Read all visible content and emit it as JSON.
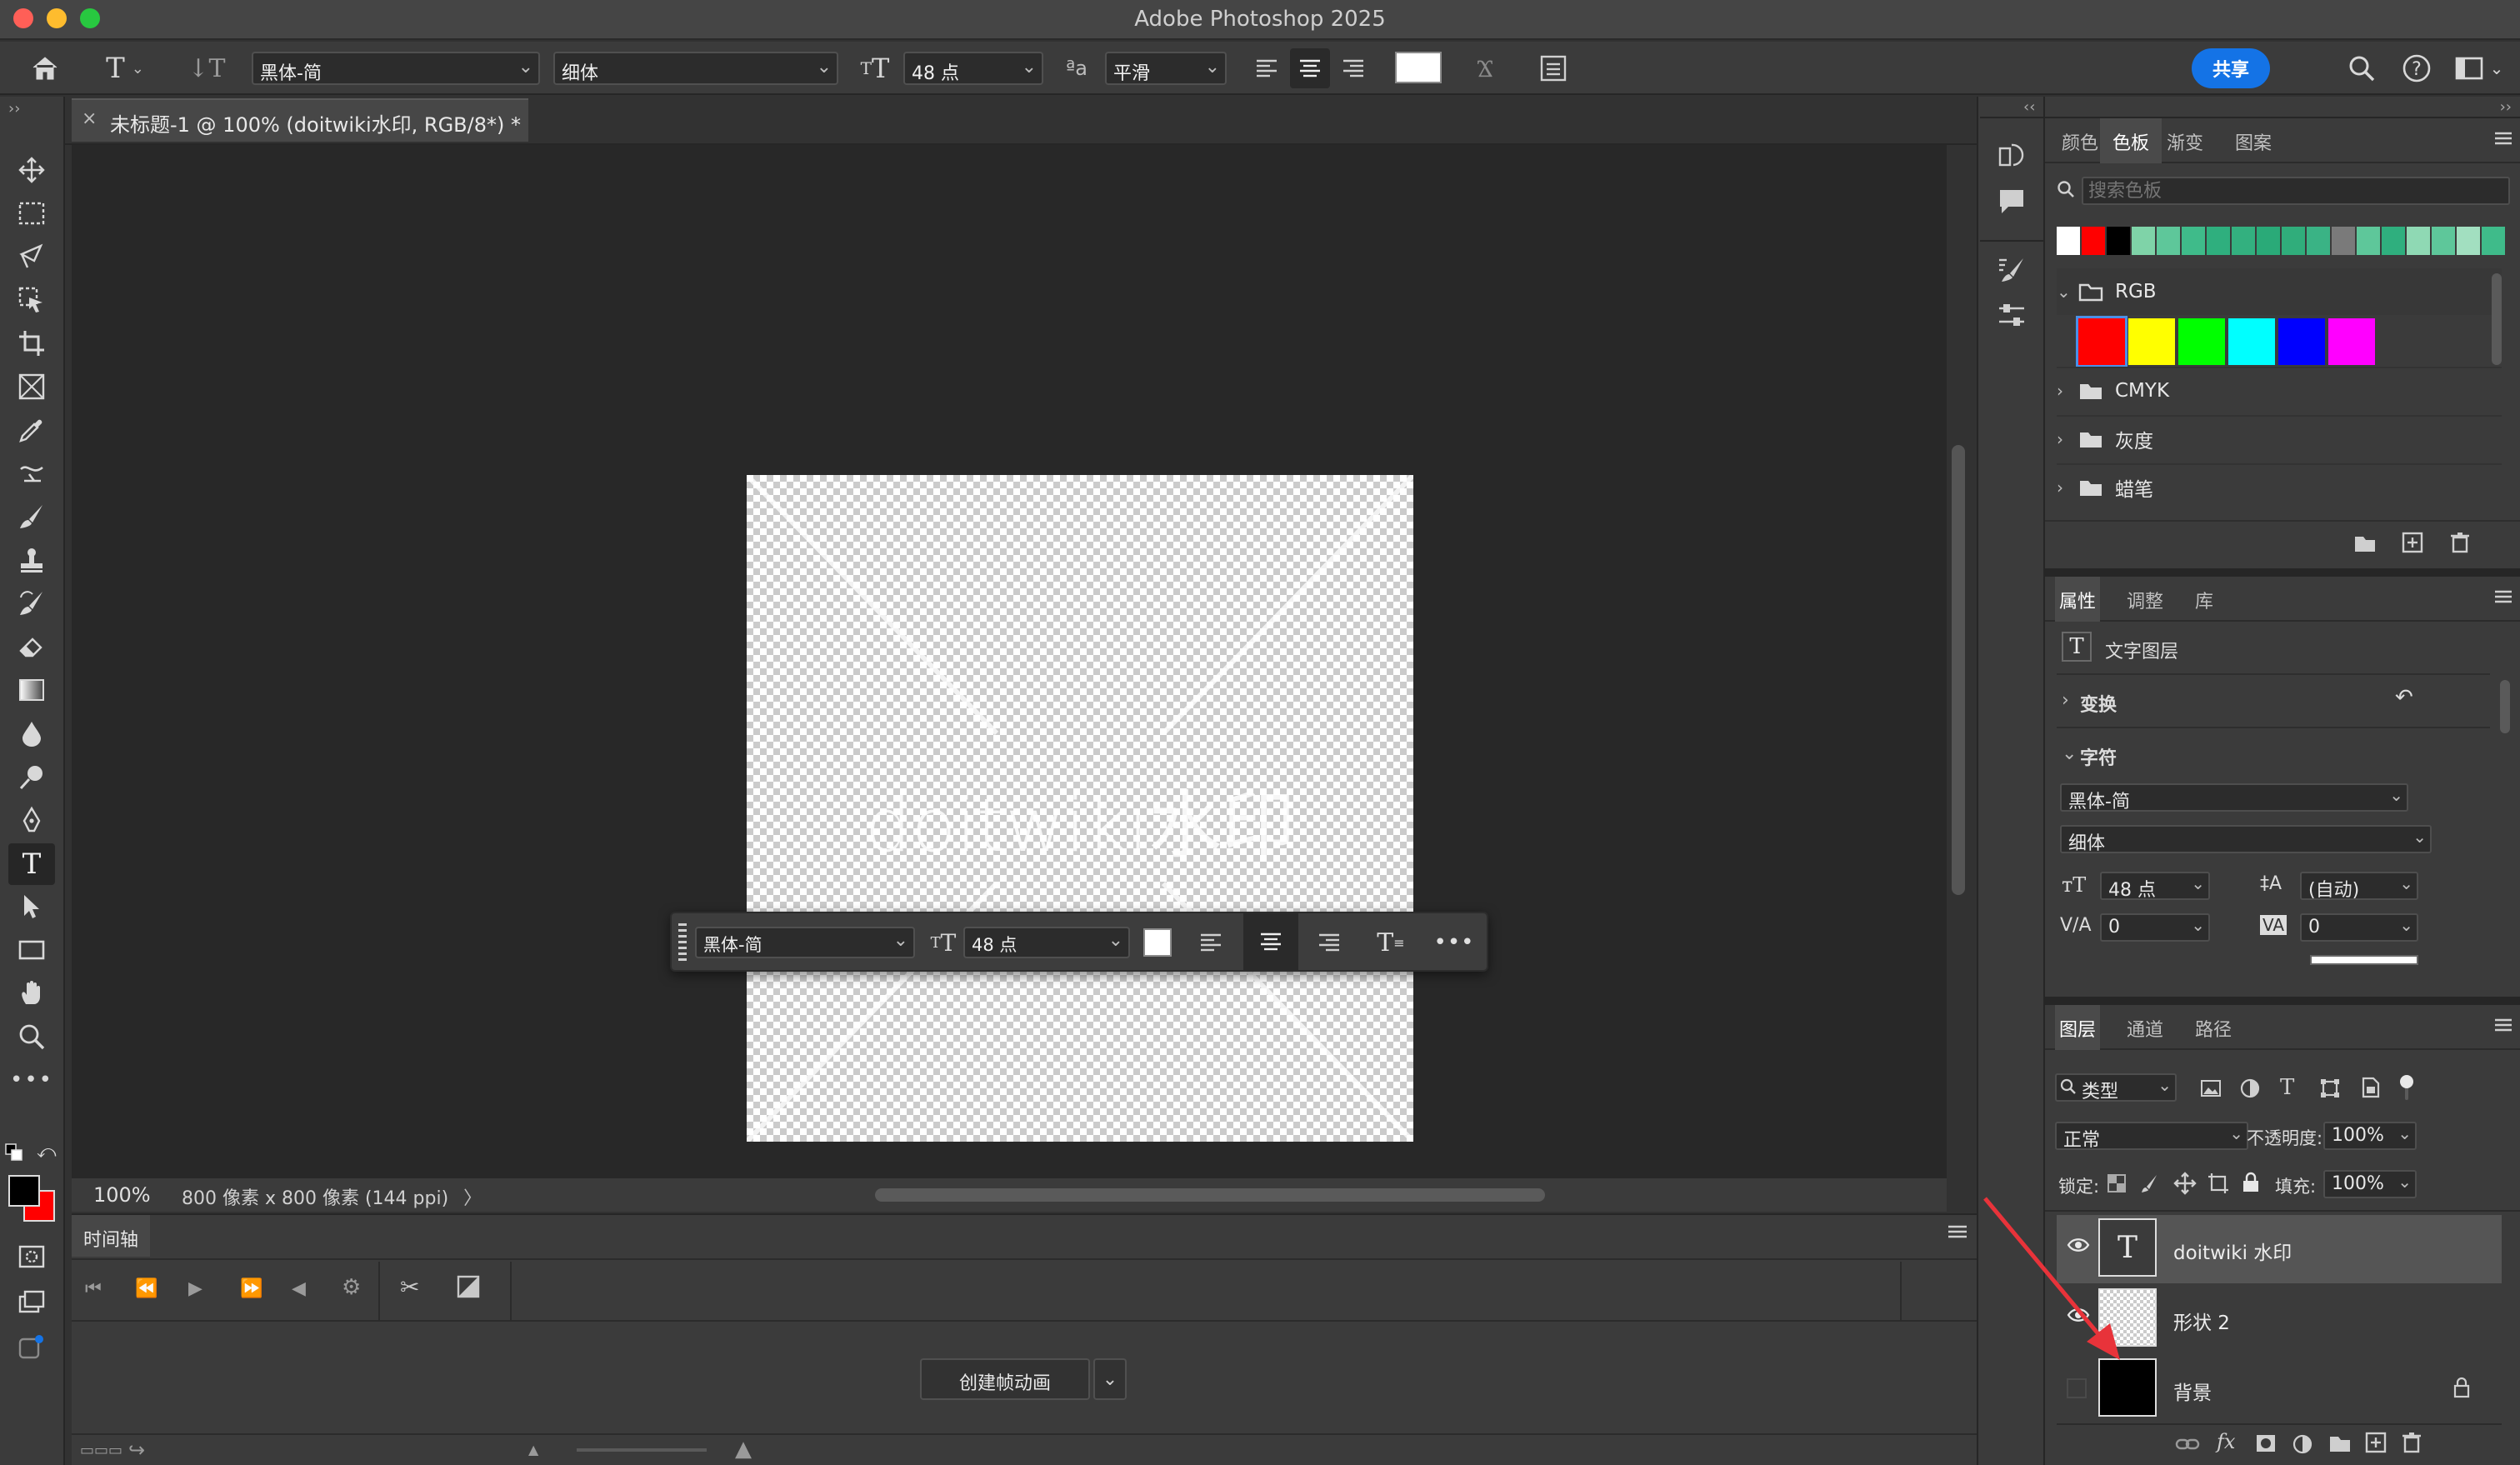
{
  "app": {
    "title": "Adobe Photoshop 2025",
    "traffic_lights": {
      "close": "#ff5f57",
      "minimize": "#febc2e",
      "zoom": "#28c840"
    }
  },
  "options_bar": {
    "font_family": "黑体-简",
    "font_style": "细体",
    "font_size": "48 点",
    "anti_alias": "平滑",
    "text_color": "#ffffff",
    "share_label": "共享",
    "share_color": "#1473e6"
  },
  "document": {
    "tab_title": "未标题-1 @ 100% (doitwiki水印, RGB/8*) *",
    "watermark_text": "doitwiki水印",
    "zoom": "100%",
    "info": "800 像素 x 800 像素 (144 ppi)"
  },
  "context_bar": {
    "font_family": "黑体-简",
    "font_size": "48 点"
  },
  "timeline": {
    "tab": "时间轴",
    "create_button": "创建帧动画"
  },
  "swatches_panel": {
    "tabs": [
      "颜色",
      "色板",
      "渐变",
      "图案"
    ],
    "active_tab": "色板",
    "search_placeholder": "搜索色板",
    "recent": [
      "#ffffff",
      "#ff0000",
      "#000000",
      "#7fd3a8",
      "#5ec79a",
      "#3fbb8a",
      "#2faf7e",
      "#33b07f",
      "#2aaa78",
      "#30ad7b",
      "#3ab385",
      "#7a7a7a",
      "#5ec79a",
      "#2faf7e",
      "#8fd9b4",
      "#5ec79a",
      "#a2dfc0",
      "#3fbb8a"
    ],
    "groups": [
      {
        "name": "RGB",
        "open": true,
        "colors": [
          "#ff0000",
          "#ffff00",
          "#00ff00",
          "#00ffff",
          "#0000ff",
          "#ff00ff"
        ]
      },
      {
        "name": "CMYK",
        "open": false
      },
      {
        "name": "灰度",
        "open": false
      },
      {
        "name": "蜡笔",
        "open": false
      }
    ]
  },
  "properties_panel": {
    "tabs": [
      "属性",
      "调整",
      "库"
    ],
    "active_tab": "属性",
    "layer_kind": "文字图层",
    "transform_label": "变换",
    "character_label": "字符",
    "font_family": "黑体-简",
    "font_style": "细体",
    "size": "48 点",
    "leading": "(自动)",
    "kerning": "0",
    "tracking": "0"
  },
  "layers_panel": {
    "tabs": [
      "图层",
      "通道",
      "路径"
    ],
    "active_tab": "图层",
    "filter_kind": "类型",
    "blend_mode": "正常",
    "opacity_label": "不透明度:",
    "opacity": "100%",
    "lock_label": "锁定:",
    "fill_label": "填充:",
    "fill": "100%",
    "layers": [
      {
        "name": "doitwiki 水印",
        "type": "text",
        "visible": true,
        "selected": true
      },
      {
        "name": "形状 2",
        "type": "shape",
        "visible": true,
        "selected": false
      },
      {
        "name": "背景",
        "type": "background",
        "visible": false,
        "locked": true
      }
    ]
  }
}
